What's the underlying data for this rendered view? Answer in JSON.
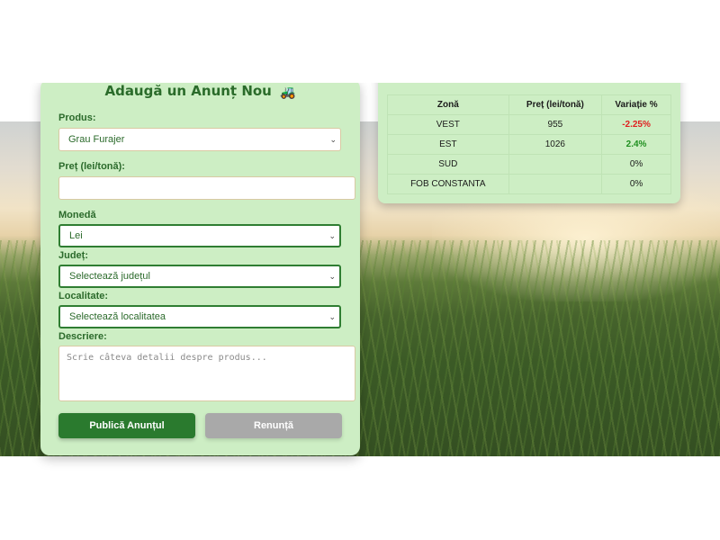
{
  "form": {
    "title": "Adaugă un Anunț Nou",
    "title_icon": "🚜",
    "product_label": "Produs:",
    "product_value": "Grau Furajer",
    "price_label": "Preț (lei/tonă):",
    "price_value": "",
    "currency_label": "Monedă",
    "currency_value": "Lei",
    "county_label": "Județ:",
    "county_value": "Selectează județul",
    "locality_label": "Localitate:",
    "locality_value": "Selectează localitatea",
    "description_label": "Descriere:",
    "description_placeholder": "Scrie câteva detalii despre produs...",
    "publish_button": "Publică Anunțul",
    "cancel_button": "Renunță"
  },
  "prices": {
    "headers": [
      "Zonă",
      "Preț (lei/tonă)",
      "Variație %"
    ],
    "rows": [
      {
        "zone": "VEST",
        "price": "955",
        "variation": "-2.25%"
      },
      {
        "zone": "EST",
        "price": "1026",
        "variation": "2.4%"
      },
      {
        "zone": "SUD",
        "price": "",
        "variation": "0%"
      },
      {
        "zone": "FOB CONSTANTA",
        "price": "",
        "variation": "0%"
      }
    ]
  },
  "colors": {
    "card_bg": "#cdeec4",
    "accent_green": "#2a7a2e",
    "negative": "#e02020",
    "positive": "#1f8f1f"
  }
}
